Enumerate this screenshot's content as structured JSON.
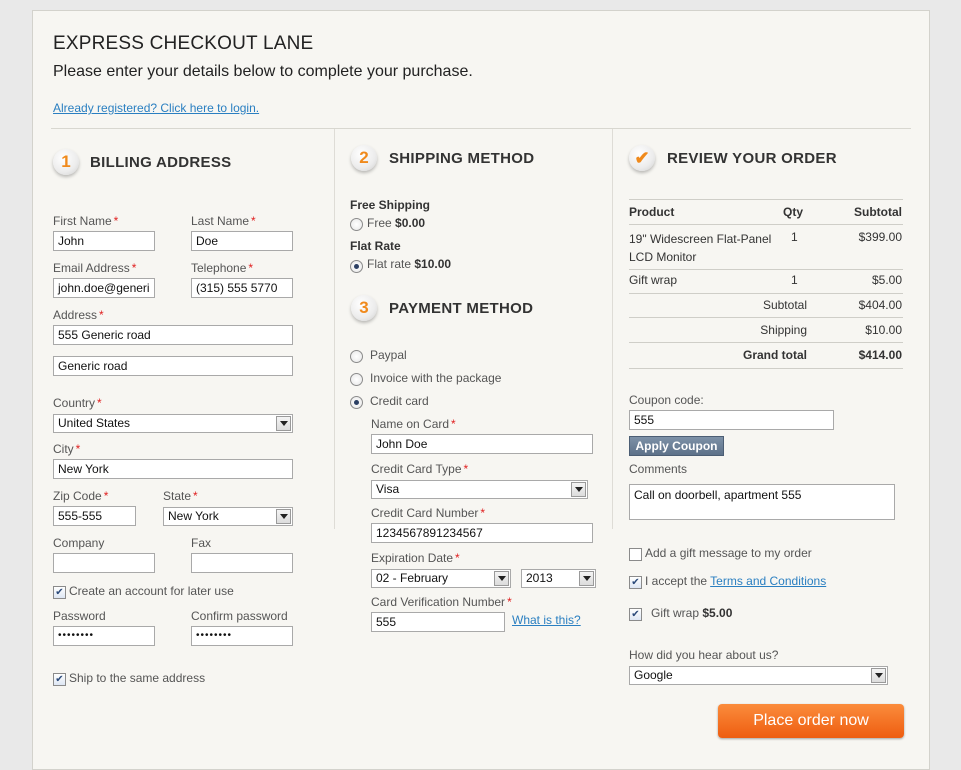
{
  "header": {
    "title": "EXPRESS CHECKOUT LANE",
    "subtitle": "Please enter your details below to complete your purchase.",
    "login_link": "Already registered? Click here to login."
  },
  "billing": {
    "step": "1",
    "title": "BILLING ADDRESS",
    "first_name_label": "First Name",
    "first_name": "John",
    "last_name_label": "Last Name",
    "last_name": "Doe",
    "email_label": "Email Address",
    "email": "john.doe@generi",
    "telephone_label": "Telephone",
    "telephone": "(315) 555 5770",
    "address_label": "Address",
    "address1": "555 Generic road",
    "address2": "Generic road",
    "country_label": "Country",
    "country": "United States",
    "city_label": "City",
    "city": "New York",
    "zip_label": "Zip Code",
    "zip": "555-555",
    "state_label": "State",
    "state": "New York",
    "company_label": "Company",
    "company": "",
    "fax_label": "Fax",
    "fax": "",
    "create_account_label": "Create an account for later use",
    "create_account_checked": true,
    "password_label": "Password",
    "password": "••••••••",
    "confirm_password_label": "Confirm password",
    "confirm_password": "••••••••",
    "ship_same_label": "Ship to the same address",
    "ship_same_checked": true,
    "required_mark": "*"
  },
  "shipping": {
    "step": "2",
    "title": "SHIPPING METHOD",
    "free_group": "Free Shipping",
    "free_option": "Free",
    "free_price": "$0.00",
    "flat_group": "Flat Rate",
    "flat_option": "Flat rate",
    "flat_price": "$10.00",
    "selected": "flat"
  },
  "payment": {
    "step": "3",
    "title": "PAYMENT METHOD",
    "options": [
      "Paypal",
      "Invoice with the package",
      "Credit card"
    ],
    "selected": "Credit card",
    "name_on_card_label": "Name on Card",
    "name_on_card": "John Doe",
    "card_type_label": "Credit Card Type",
    "card_type": "Visa",
    "card_number_label": "Credit Card Number",
    "card_number": "1234567891234567",
    "expiration_label": "Expiration Date",
    "exp_month": "02 - February",
    "exp_year": "2013",
    "cvn_label": "Card Verification Number",
    "cvn": "555",
    "what_is_this": "What is this?"
  },
  "review": {
    "title": "REVIEW YOUR ORDER",
    "columns": [
      "Product",
      "Qty",
      "Subtotal"
    ],
    "items": [
      {
        "product_line1": "19\" Widescreen Flat-Panel",
        "product_line2": "LCD Monitor",
        "qty": "1",
        "subtotal": "$399.00"
      },
      {
        "product_line1": "Gift wrap",
        "product_line2": "",
        "qty": "1",
        "subtotal": "$5.00"
      }
    ],
    "subtotal_label": "Subtotal",
    "subtotal": "$404.00",
    "shipping_label": "Shipping",
    "shipping": "$10.00",
    "grand_total_label": "Grand total",
    "grand_total": "$414.00",
    "coupon_label": "Coupon code:",
    "coupon_code": "555",
    "apply_coupon": "Apply Coupon",
    "comments_label": "Comments",
    "comments": "Call on doorbell, apartment 555",
    "gift_message_label": "Add a gift message to my order",
    "gift_message_checked": false,
    "accept_prefix": "I accept the ",
    "terms_link": "Terms and Conditions",
    "accept_checked": true,
    "gift_wrap_label": "Gift wrap",
    "gift_wrap_price": "$5.00",
    "gift_wrap_checked": true,
    "hear_label": "How did you hear about us?",
    "hear_value": "Google",
    "place_order": "Place order now"
  },
  "colors": {
    "accent_orange": "#f08a1c",
    "link_blue": "#2a7fc1",
    "coupon_button": "#6a7e95",
    "place_order_button": "#f4741f",
    "required": "#e02020"
  }
}
